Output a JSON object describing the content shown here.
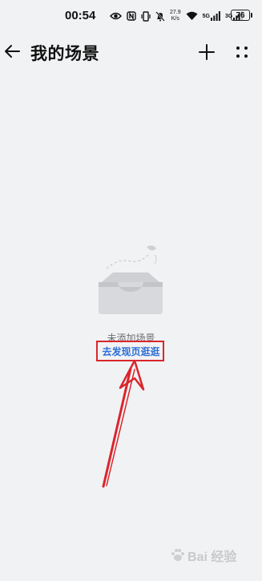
{
  "status_bar": {
    "time": "00:54",
    "speed_value": "27.9",
    "speed_unit": "K/s",
    "net_5g": "5G",
    "net_3g": "3G",
    "battery": "76"
  },
  "header": {
    "title": "我的场景"
  },
  "empty_state": {
    "message": "未添加场景",
    "link": "去发现页逛逛"
  },
  "watermark": {
    "text": "Bai 经验"
  },
  "colors": {
    "background": "#f1f2f4",
    "link": "#2d6ed6",
    "annotation": "#d9262c"
  },
  "icons": [
    "back-arrow-icon",
    "plus-icon",
    "more-dots-icon",
    "eye-icon",
    "nfc-icon",
    "vibrate-icon",
    "mute-bell-icon",
    "wifi-icon",
    "signal-icon",
    "battery-icon",
    "empty-box-icon"
  ]
}
